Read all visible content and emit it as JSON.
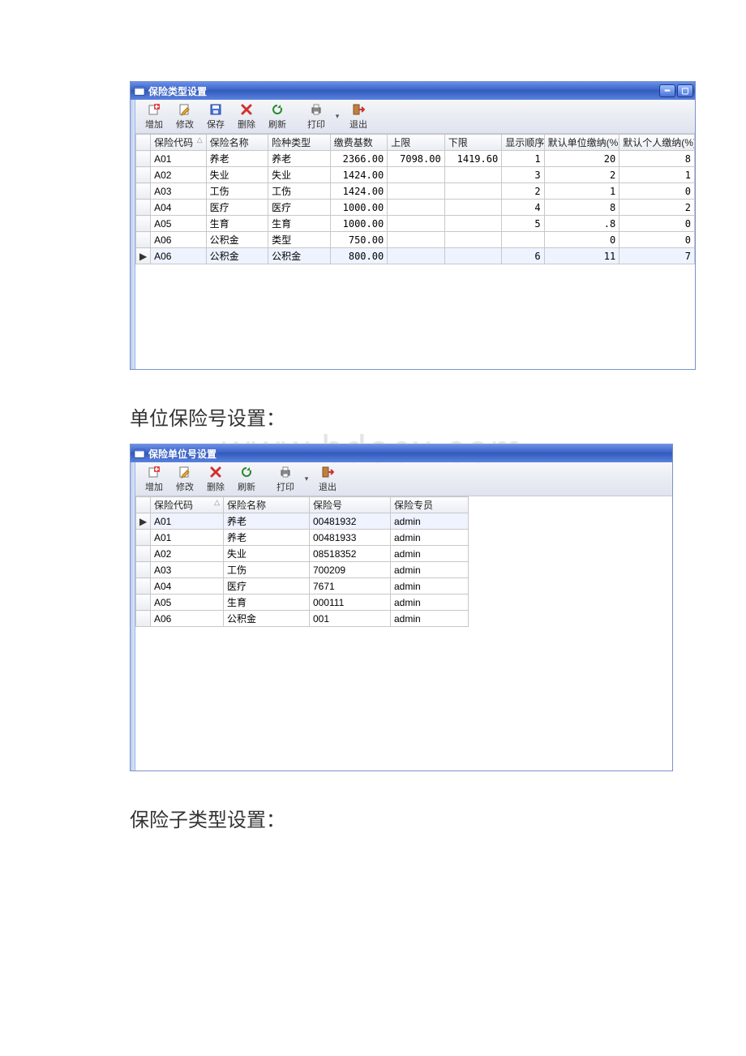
{
  "captions": {
    "unit_no": "单位保险号设置：",
    "sub_type": "保险子类型设置："
  },
  "watermark": "www.bdocx.com",
  "toolbar_labels": {
    "add": "增加",
    "edit": "修改",
    "save": "保存",
    "delete": "删除",
    "refresh": "刷新",
    "print": "打印",
    "exit": "退出"
  },
  "win1": {
    "title": "保险类型设置",
    "columns": [
      "保险代码",
      "保险名称",
      "险种类型",
      "缴费基数",
      "上限",
      "下限",
      "显示顺序",
      "默认单位缴纳(%)",
      "默认个人缴纳(%)"
    ],
    "selected": 6,
    "rows": [
      {
        "code": "A01",
        "name": "养老",
        "type": "养老",
        "base": "2366.00",
        "hi": "7098.00",
        "lo": "1419.60",
        "ord": "1",
        "u": "20",
        "p": "8"
      },
      {
        "code": "A02",
        "name": "失业",
        "type": "失业",
        "base": "1424.00",
        "hi": "",
        "lo": "",
        "ord": "3",
        "u": "2",
        "p": "1"
      },
      {
        "code": "A03",
        "name": "工伤",
        "type": "工伤",
        "base": "1424.00",
        "hi": "",
        "lo": "",
        "ord": "2",
        "u": "1",
        "p": "0"
      },
      {
        "code": "A04",
        "name": "医疗",
        "type": "医疗",
        "base": "1000.00",
        "hi": "",
        "lo": "",
        "ord": "4",
        "u": "8",
        "p": "2"
      },
      {
        "code": "A05",
        "name": "生育",
        "type": "生育",
        "base": "1000.00",
        "hi": "",
        "lo": "",
        "ord": "5",
        "u": ".8",
        "p": "0"
      },
      {
        "code": "A06",
        "name": "公积金",
        "type": "类型",
        "base": "750.00",
        "hi": "",
        "lo": "",
        "ord": "",
        "u": "0",
        "p": "0"
      },
      {
        "code": "A06",
        "name": "公积金",
        "type": "公积金",
        "base": "800.00",
        "hi": "",
        "lo": "",
        "ord": "6",
        "u": "11",
        "p": "7"
      }
    ]
  },
  "win2": {
    "title": "保险单位号设置",
    "columns": [
      "保险代码",
      "保险名称",
      "保险号",
      "保险专员"
    ],
    "selected": 0,
    "rows": [
      {
        "code": "A01",
        "name": "养老",
        "no": "00481932",
        "admin": "admin"
      },
      {
        "code": "A01",
        "name": "养老",
        "no": "00481933",
        "admin": "admin"
      },
      {
        "code": "A02",
        "name": "失业",
        "no": "08518352",
        "admin": "admin"
      },
      {
        "code": "A03",
        "name": "工伤",
        "no": "700209",
        "admin": "admin"
      },
      {
        "code": "A04",
        "name": "医疗",
        "no": "7671",
        "admin": "admin"
      },
      {
        "code": "A05",
        "name": "生育",
        "no": "000111",
        "admin": "admin"
      },
      {
        "code": "A06",
        "name": "公积金",
        "no": "001",
        "admin": "admin"
      }
    ]
  }
}
